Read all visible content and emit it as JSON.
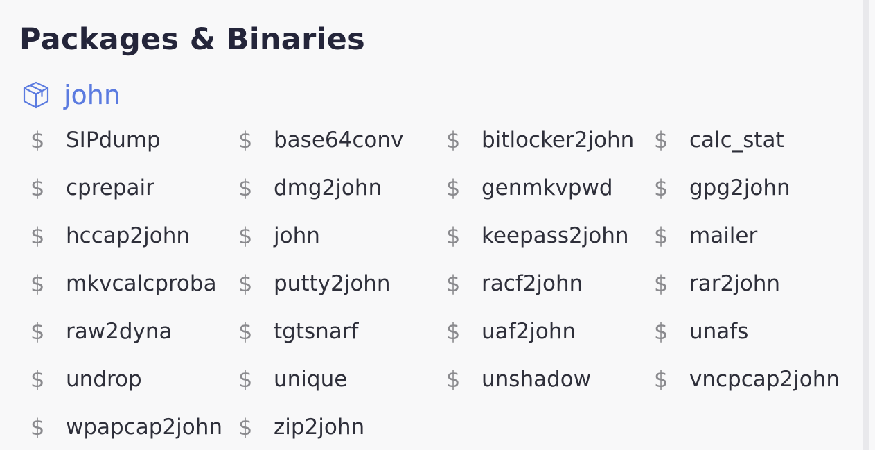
{
  "section": {
    "title": "Packages & Binaries"
  },
  "package": {
    "name": "john",
    "icon": "package-box-icon",
    "color": "#5b7be0"
  },
  "binaries": {
    "prompt_symbol": "$",
    "items": [
      "SIPdump",
      "base64conv",
      "bitlocker2john",
      "calc_stat",
      "cprepair",
      "dmg2john",
      "genmkvpwd",
      "gpg2john",
      "hccap2john",
      "john",
      "keepass2john",
      "mailer",
      "mkvcalcproba",
      "putty2john",
      "racf2john",
      "rar2john",
      "raw2dyna",
      "tgtsnarf",
      "uaf2john",
      "unafs",
      "undrop",
      "unique",
      "unshadow",
      "vncpcap2john",
      "wpapcap2john",
      "zip2john"
    ]
  }
}
